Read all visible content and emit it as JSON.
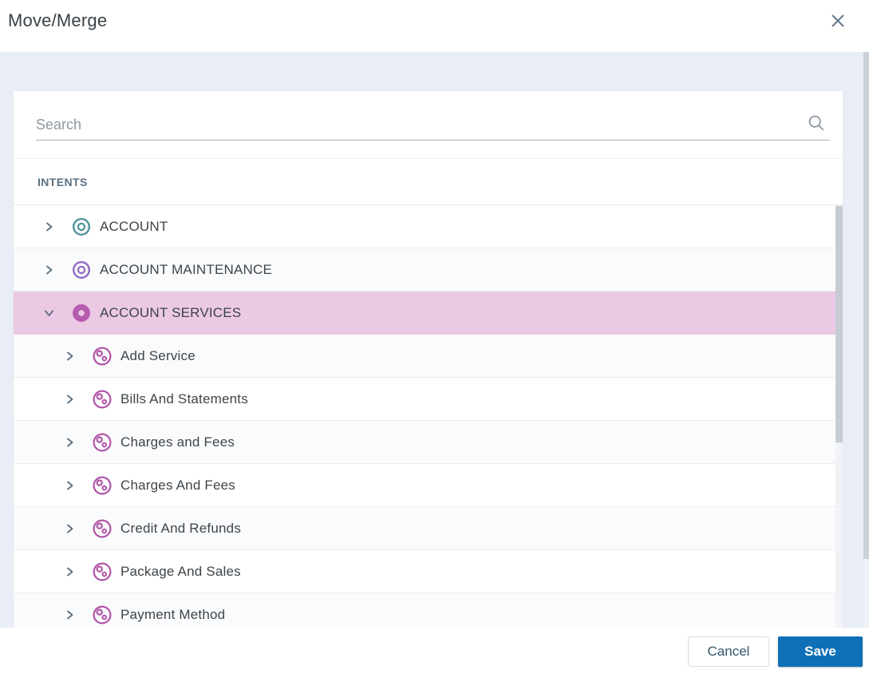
{
  "window": {
    "title": "Move/Merge"
  },
  "search": {
    "placeholder": "Search"
  },
  "tree": {
    "section_label": "INTENTS",
    "items": [
      {
        "label": "ACCOUNT",
        "level": 0,
        "expanded": false,
        "selected": false,
        "icon": "intent-rings",
        "icon_color": "#4F939B"
      },
      {
        "label": "ACCOUNT MAINTENANCE",
        "level": 0,
        "expanded": false,
        "selected": false,
        "icon": "intent-rings",
        "icon_color": "#9069C4"
      },
      {
        "label": "ACCOUNT SERVICES",
        "level": 0,
        "expanded": true,
        "selected": true,
        "icon": "intent-donut",
        "icon_color": "#B55CAE"
      },
      {
        "label": "Add Service",
        "level": 1,
        "expanded": false,
        "selected": false,
        "icon": "sub-intent",
        "icon_color": "#B153A8"
      },
      {
        "label": "Bills And Statements",
        "level": 1,
        "expanded": false,
        "selected": false,
        "icon": "sub-intent",
        "icon_color": "#B153A8"
      },
      {
        "label": "Charges and Fees",
        "level": 1,
        "expanded": false,
        "selected": false,
        "icon": "sub-intent",
        "icon_color": "#B153A8"
      },
      {
        "label": "Charges And Fees",
        "level": 1,
        "expanded": false,
        "selected": false,
        "icon": "sub-intent",
        "icon_color": "#B153A8"
      },
      {
        "label": "Credit And Refunds",
        "level": 1,
        "expanded": false,
        "selected": false,
        "icon": "sub-intent",
        "icon_color": "#B153A8"
      },
      {
        "label": "Package And Sales",
        "level": 1,
        "expanded": false,
        "selected": false,
        "icon": "sub-intent",
        "icon_color": "#B153A8"
      },
      {
        "label": "Payment Method",
        "level": 1,
        "expanded": false,
        "selected": false,
        "icon": "sub-intent",
        "icon_color": "#B153A8"
      }
    ]
  },
  "buttons": {
    "cancel": "Cancel",
    "save": "Save"
  },
  "colors": {
    "body_bg": "#E9EEF6",
    "selected_row_bg": "#EBC9E4",
    "save_button_bg": "#0F70B7",
    "chevron": "#5A6E7F",
    "icon_close": "#64798C",
    "search_icon": "#8D97A1"
  }
}
